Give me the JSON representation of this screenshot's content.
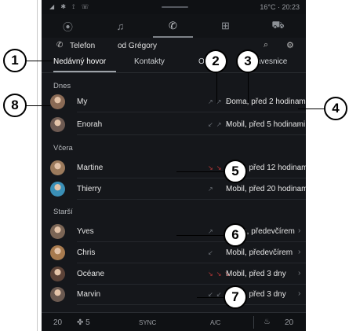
{
  "status_bar": {
    "left_icons": "◢ ✱ ⟟ ☏",
    "temperature": "16°C",
    "time": "20:23"
  },
  "app_bar": {
    "items": [
      {
        "name": "navigation",
        "icon": "location-pin-icon",
        "glyph": "⦿"
      },
      {
        "name": "music",
        "icon": "music-note-icon",
        "glyph": "♫"
      },
      {
        "name": "phone",
        "icon": "phone-icon",
        "glyph": "✆",
        "active": true
      },
      {
        "name": "apps",
        "icon": "apps-grid-icon",
        "glyph": "⊞"
      },
      {
        "name": "car",
        "icon": "car-icon",
        "glyph": "⛟"
      }
    ]
  },
  "phone_header": {
    "app_label": "Telefon",
    "device_label": "od Grégory"
  },
  "tabs": {
    "recent": "Nedávný hovor",
    "contacts": "Kontakty",
    "partial": "O",
    "keypad": "Klávesnice"
  },
  "sections": {
    "today": "Dnes",
    "yesterday": "Včera",
    "older": "Starší"
  },
  "calls": [
    {
      "name": "My",
      "direction": "outgoing",
      "arrows": "↗↗↗",
      "detail": "Doma, před 2 hodinami",
      "avatar_color": "#8a6a55"
    },
    {
      "name": "Enorah",
      "direction": "incoming",
      "arrows": "↙↗↗",
      "detail": "Mobil, před 5 hodinami",
      "avatar_color": "#6d5a52"
    },
    {
      "name": "Martine",
      "direction": "missed",
      "arrows": "↘↘",
      "detail": "Mobil, před 12 hodinami",
      "avatar_color": "#9b7a5c"
    },
    {
      "name": "Thierry",
      "direction": "outgoing",
      "arrows": "↗",
      "detail": "Mobil, před 20 hodinami",
      "avatar_color": "#3a8fb6"
    },
    {
      "name": "Yves",
      "direction": "outgoing",
      "arrows": "↗",
      "detail": "Doma, předevčírem",
      "avatar_color": "#7b6555"
    },
    {
      "name": "Chris",
      "direction": "incoming",
      "arrows": "↙",
      "detail": "Mobil, předevčírem",
      "avatar_color": "#a77a4e"
    },
    {
      "name": "Océane",
      "direction": "missed",
      "arrows": "↘↘↘",
      "detail": "Mobil, před 3 dny",
      "avatar_color": "#5c4338"
    },
    {
      "name": "Marvin",
      "direction": "incoming",
      "arrows": "↙↙↙",
      "detail": "Mobil, před 3 dny",
      "avatar_color": "#6a5950"
    }
  ],
  "climate": {
    "temp_left": "20",
    "fan": "5",
    "sync": "SYNC",
    "ac": "A/C",
    "temp_right": "20"
  },
  "callouts": [
    "1",
    "2",
    "3",
    "4",
    "5",
    "6",
    "7",
    "8"
  ],
  "colors": {
    "background": "#15171b",
    "missed": "#c23a3a",
    "text": "#e6e6e6"
  }
}
